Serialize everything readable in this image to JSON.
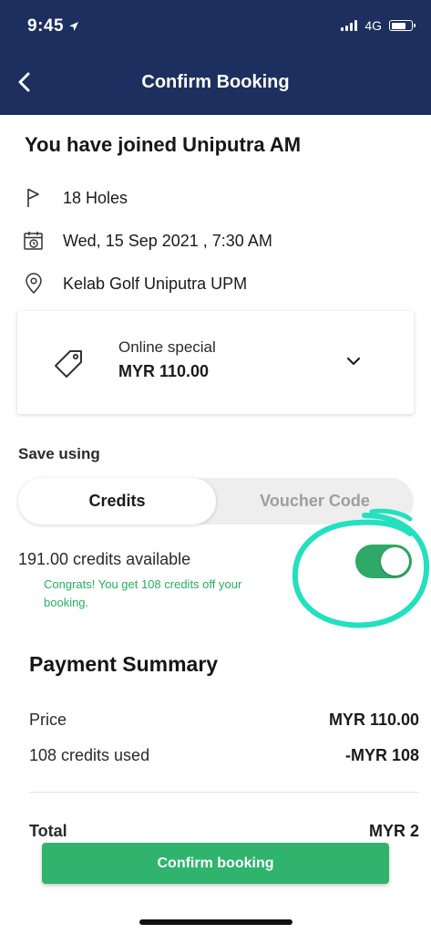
{
  "status_bar": {
    "time": "9:45",
    "network": "4G",
    "location_icon": "location-arrow-icon"
  },
  "header": {
    "title": "Confirm Booking",
    "back_icon": "chevron-left-icon"
  },
  "booking": {
    "title": "You have joined Uniputra AM",
    "holes": "18 Holes",
    "datetime": "Wed, 15 Sep 2021 , 7:30 AM",
    "venue": "Kelab Golf Uniputra UPM"
  },
  "rate": {
    "label": "Online special",
    "price": "MYR 110.00",
    "expand_icon": "chevron-down-icon"
  },
  "save_using": {
    "heading": "Save using",
    "tabs": [
      {
        "label": "Credits",
        "selected": true
      },
      {
        "label": "Voucher Code",
        "selected": false
      }
    ],
    "credits_available": "191.00 credits available",
    "congrats": "Congrats! You get 108 credits off your booking.",
    "toggle_on": true
  },
  "payment_summary": {
    "title": "Payment Summary",
    "rows": [
      {
        "label": "Price",
        "value": "MYR 110.00"
      },
      {
        "label": "108 credits used",
        "value": "-MYR 108"
      }
    ],
    "total_label": "Total",
    "total_value": "MYR 2"
  },
  "actions": {
    "confirm_label": "Confirm booking"
  },
  "colors": {
    "header_bg": "#1c2f5e",
    "accent_green": "#2fb36d",
    "annotation_teal": "#22e0c0"
  }
}
